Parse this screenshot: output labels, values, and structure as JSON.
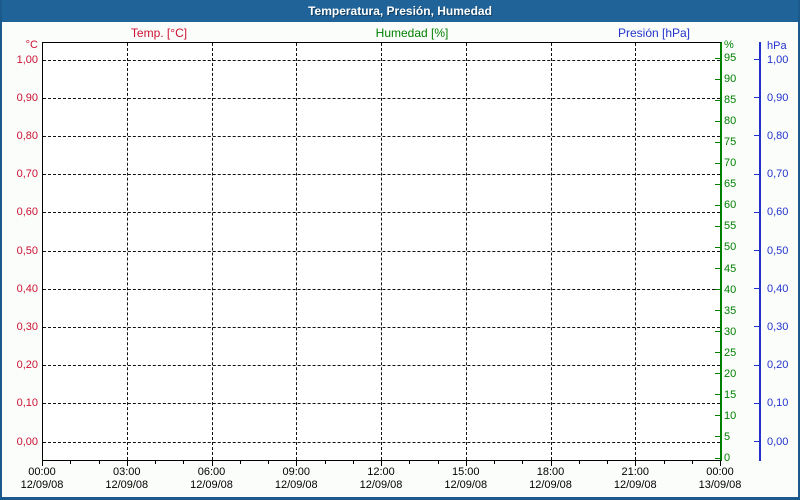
{
  "window": {
    "title": "Temperatura, Presión, Humedad"
  },
  "legend": [
    {
      "label": "Temp. [°C]",
      "color": "#cc1133"
    },
    {
      "label": "Humedad [%]",
      "color": "#008000"
    },
    {
      "label": "Presión [hPa]",
      "color": "#2233cc"
    }
  ],
  "chart_data": {
    "type": "line",
    "title": "Temperatura, Presión, Humedad",
    "grid": true,
    "plot_background": "#ffffff",
    "series": [
      {
        "name": "Temp. [°C]",
        "axis": "temperature",
        "color": "#cc1133",
        "points": []
      },
      {
        "name": "Humedad [%]",
        "axis": "humidity",
        "color": "#008000",
        "points": []
      },
      {
        "name": "Presión [hPa]",
        "axis": "pressure",
        "color": "#2233cc",
        "points": []
      }
    ],
    "y_axes": [
      {
        "id": "temperature",
        "unit": "°C",
        "side": "left",
        "color": "#cc1133",
        "min": 0,
        "max": 1,
        "step": 0.1,
        "gridlines": true,
        "tick_labels": [
          "1,00",
          "0,90",
          "0,80",
          "0,70",
          "0,60",
          "0,50",
          "0,40",
          "0,30",
          "0,20",
          "0,10",
          "0,00"
        ]
      },
      {
        "id": "humidity",
        "unit": "%",
        "side": "right-inner",
        "color": "#008000",
        "min": 0,
        "max": 95,
        "step": 5,
        "gridlines": false,
        "tick_labels": [
          "95",
          "90",
          "85",
          "80",
          "75",
          "70",
          "65",
          "60",
          "55",
          "50",
          "45",
          "40",
          "35",
          "30",
          "25",
          "20",
          "15",
          "10",
          "5",
          "0"
        ]
      },
      {
        "id": "pressure",
        "unit": "hPa",
        "side": "right-outer",
        "color": "#2233cc",
        "min": 0,
        "max": 1,
        "step": 0.1,
        "gridlines": false,
        "tick_labels": [
          "1,00",
          "0,90",
          "0,80",
          "0,70",
          "0,60",
          "0,50",
          "0,40",
          "0,30",
          "0,20",
          "0,10",
          "0,00"
        ]
      }
    ],
    "x_axis": {
      "minor_ticks_per_major_interval": 3,
      "tick_labels": [
        {
          "time": "00:00",
          "date": "12/09/08"
        },
        {
          "time": "03:00",
          "date": "12/09/08"
        },
        {
          "time": "06:00",
          "date": "12/09/08"
        },
        {
          "time": "09:00",
          "date": "12/09/08"
        },
        {
          "time": "12:00",
          "date": "12/09/08"
        },
        {
          "time": "15:00",
          "date": "12/09/08"
        },
        {
          "time": "18:00",
          "date": "12/09/08"
        },
        {
          "time": "21:00",
          "date": "12/09/08"
        },
        {
          "time": "00:00",
          "date": "13/09/08"
        }
      ]
    },
    "colors": {
      "titlebar": "#1f6398",
      "window_border": "#1c598c",
      "gridline": "#111111"
    }
  }
}
